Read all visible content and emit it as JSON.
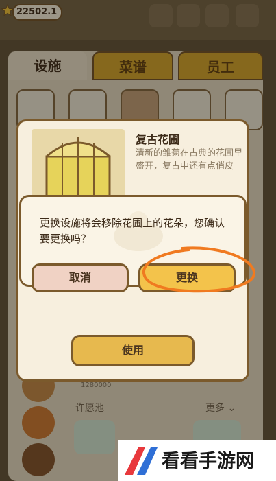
{
  "currency": {
    "value": "22502.1"
  },
  "tabs": [
    {
      "label": "设施",
      "active": true
    },
    {
      "label": "菜谱",
      "active": false
    },
    {
      "label": "员工",
      "active": false
    }
  ],
  "detail": {
    "title": "复古花圃",
    "description": "清新的雏菊在古典的花圃里盛开，复古中还有点俏皮",
    "use_label": "使用"
  },
  "confirm": {
    "message": "更换设施将会移除花圃上的花朵，您确认要更换吗？",
    "cancel_label": "取消",
    "confirm_label": "更换"
  },
  "list": {
    "section_label": "许愿池",
    "more_label": "更多",
    "price": "1280000"
  },
  "watermark": {
    "text": "看看手游网"
  },
  "colors": {
    "accent_gold": "#f3c34b",
    "border_brown": "#7b5a2c",
    "highlight_orange": "#f07a20",
    "cancel_pink": "#f0d2c4"
  }
}
